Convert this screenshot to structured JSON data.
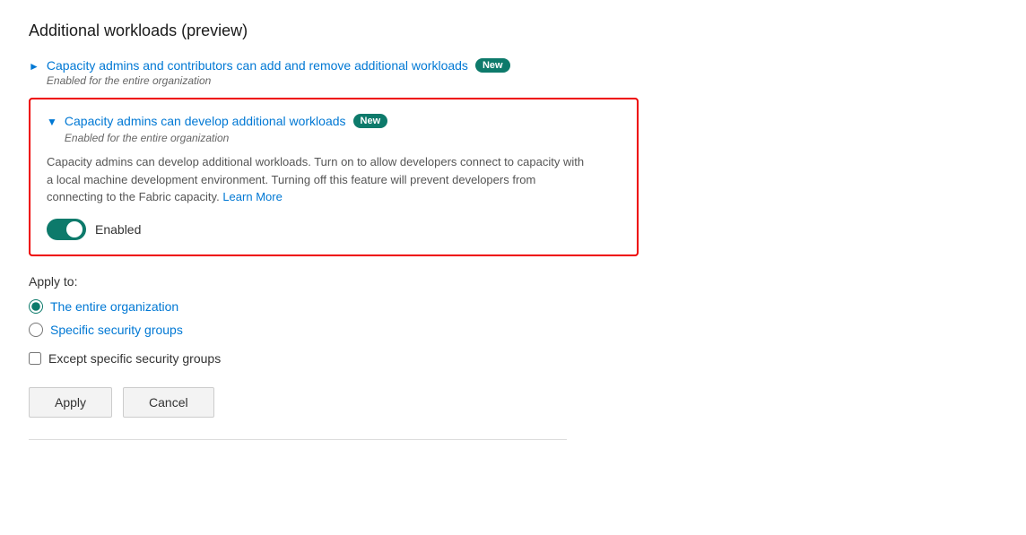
{
  "page": {
    "title": "Additional workloads (preview)"
  },
  "items": [
    {
      "id": "item1",
      "title": "Capacity admins and contributors can add and remove additional workloads",
      "badge": "New",
      "subtitle": "Enabled for the entire organization",
      "expanded": false
    },
    {
      "id": "item2",
      "title": "Capacity admins can develop additional workloads",
      "badge": "New",
      "subtitle": "Enabled for the entire organization",
      "expanded": true,
      "description_part1": "Capacity admins can develop additional workloads. Turn on to allow developers connect to capacity with a local machine development environment. Turning off this feature will prevent developers from connecting to the Fabric capacity.",
      "learn_more_label": "Learn More",
      "toggle_enabled": true,
      "toggle_label": "Enabled"
    }
  ],
  "apply_to": {
    "label": "Apply to:",
    "options": [
      {
        "value": "entire_org",
        "label": "The entire organization",
        "selected": true
      },
      {
        "value": "specific_groups",
        "label": "Specific security groups",
        "selected": false
      }
    ],
    "except_label": "Except specific security groups"
  },
  "buttons": {
    "apply_label": "Apply",
    "cancel_label": "Cancel"
  }
}
